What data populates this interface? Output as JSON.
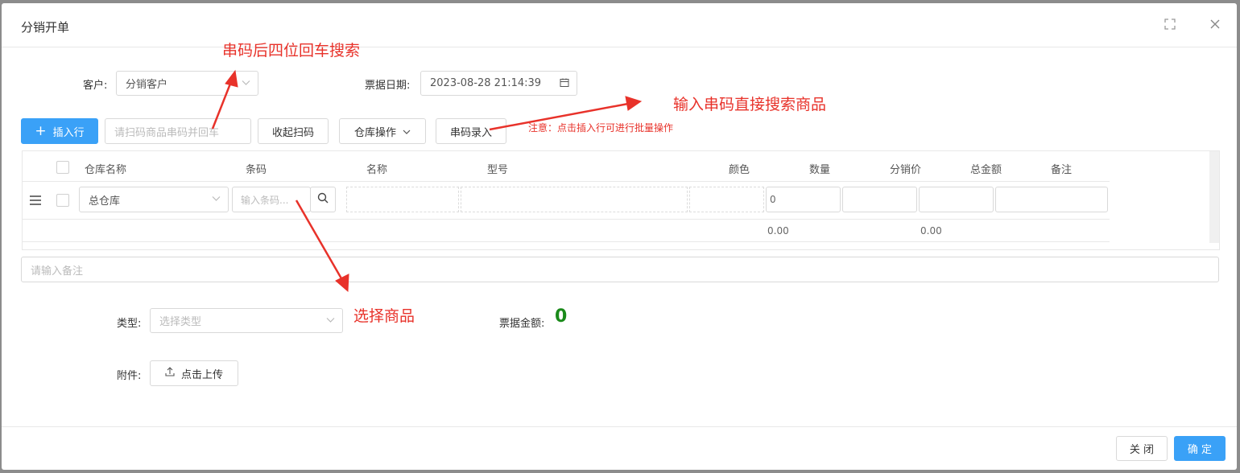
{
  "modal": {
    "title": "分销开单"
  },
  "annotations": {
    "serial_search": "串码后四位回车搜索",
    "serial_direct": "输入串码直接搜索商品",
    "select_product": "选择商品",
    "note": "注意：点击插入行可进行批量操作"
  },
  "form": {
    "customer_label": "客户:",
    "customer_value": "分销客户",
    "date_label": "票据日期:",
    "date_value": "2023-08-28 21:14:39",
    "type_label": "类型:",
    "type_placeholder": "选择类型",
    "amount_label": "票据金额:",
    "amount_value": "0",
    "attachment_label": "附件:",
    "upload_label": "点击上传",
    "remark_placeholder": "请输入备注"
  },
  "toolbar": {
    "insert_row": "插入行",
    "scan_placeholder": "请扫码商品串码并回车",
    "collapse_scan": "收起扫码",
    "warehouse_ops": "仓库操作",
    "serial_entry": "串码录入"
  },
  "table": {
    "columns": [
      "仓库名称",
      "条码",
      "名称",
      "型号",
      "颜色",
      "数量",
      "分销价",
      "总金额",
      "备注"
    ],
    "rows": [
      {
        "warehouse": "总仓库",
        "barcode_placeholder": "输入条码...",
        "quantity": "0"
      }
    ],
    "totals": {
      "quantity": "0.00",
      "amount": "0.00"
    }
  },
  "footer": {
    "close": "关 闭",
    "confirm": "确 定"
  },
  "colors": {
    "primary": "#3aa1f7",
    "annotation": "#e8322a",
    "amount": "#1a8a1a"
  }
}
